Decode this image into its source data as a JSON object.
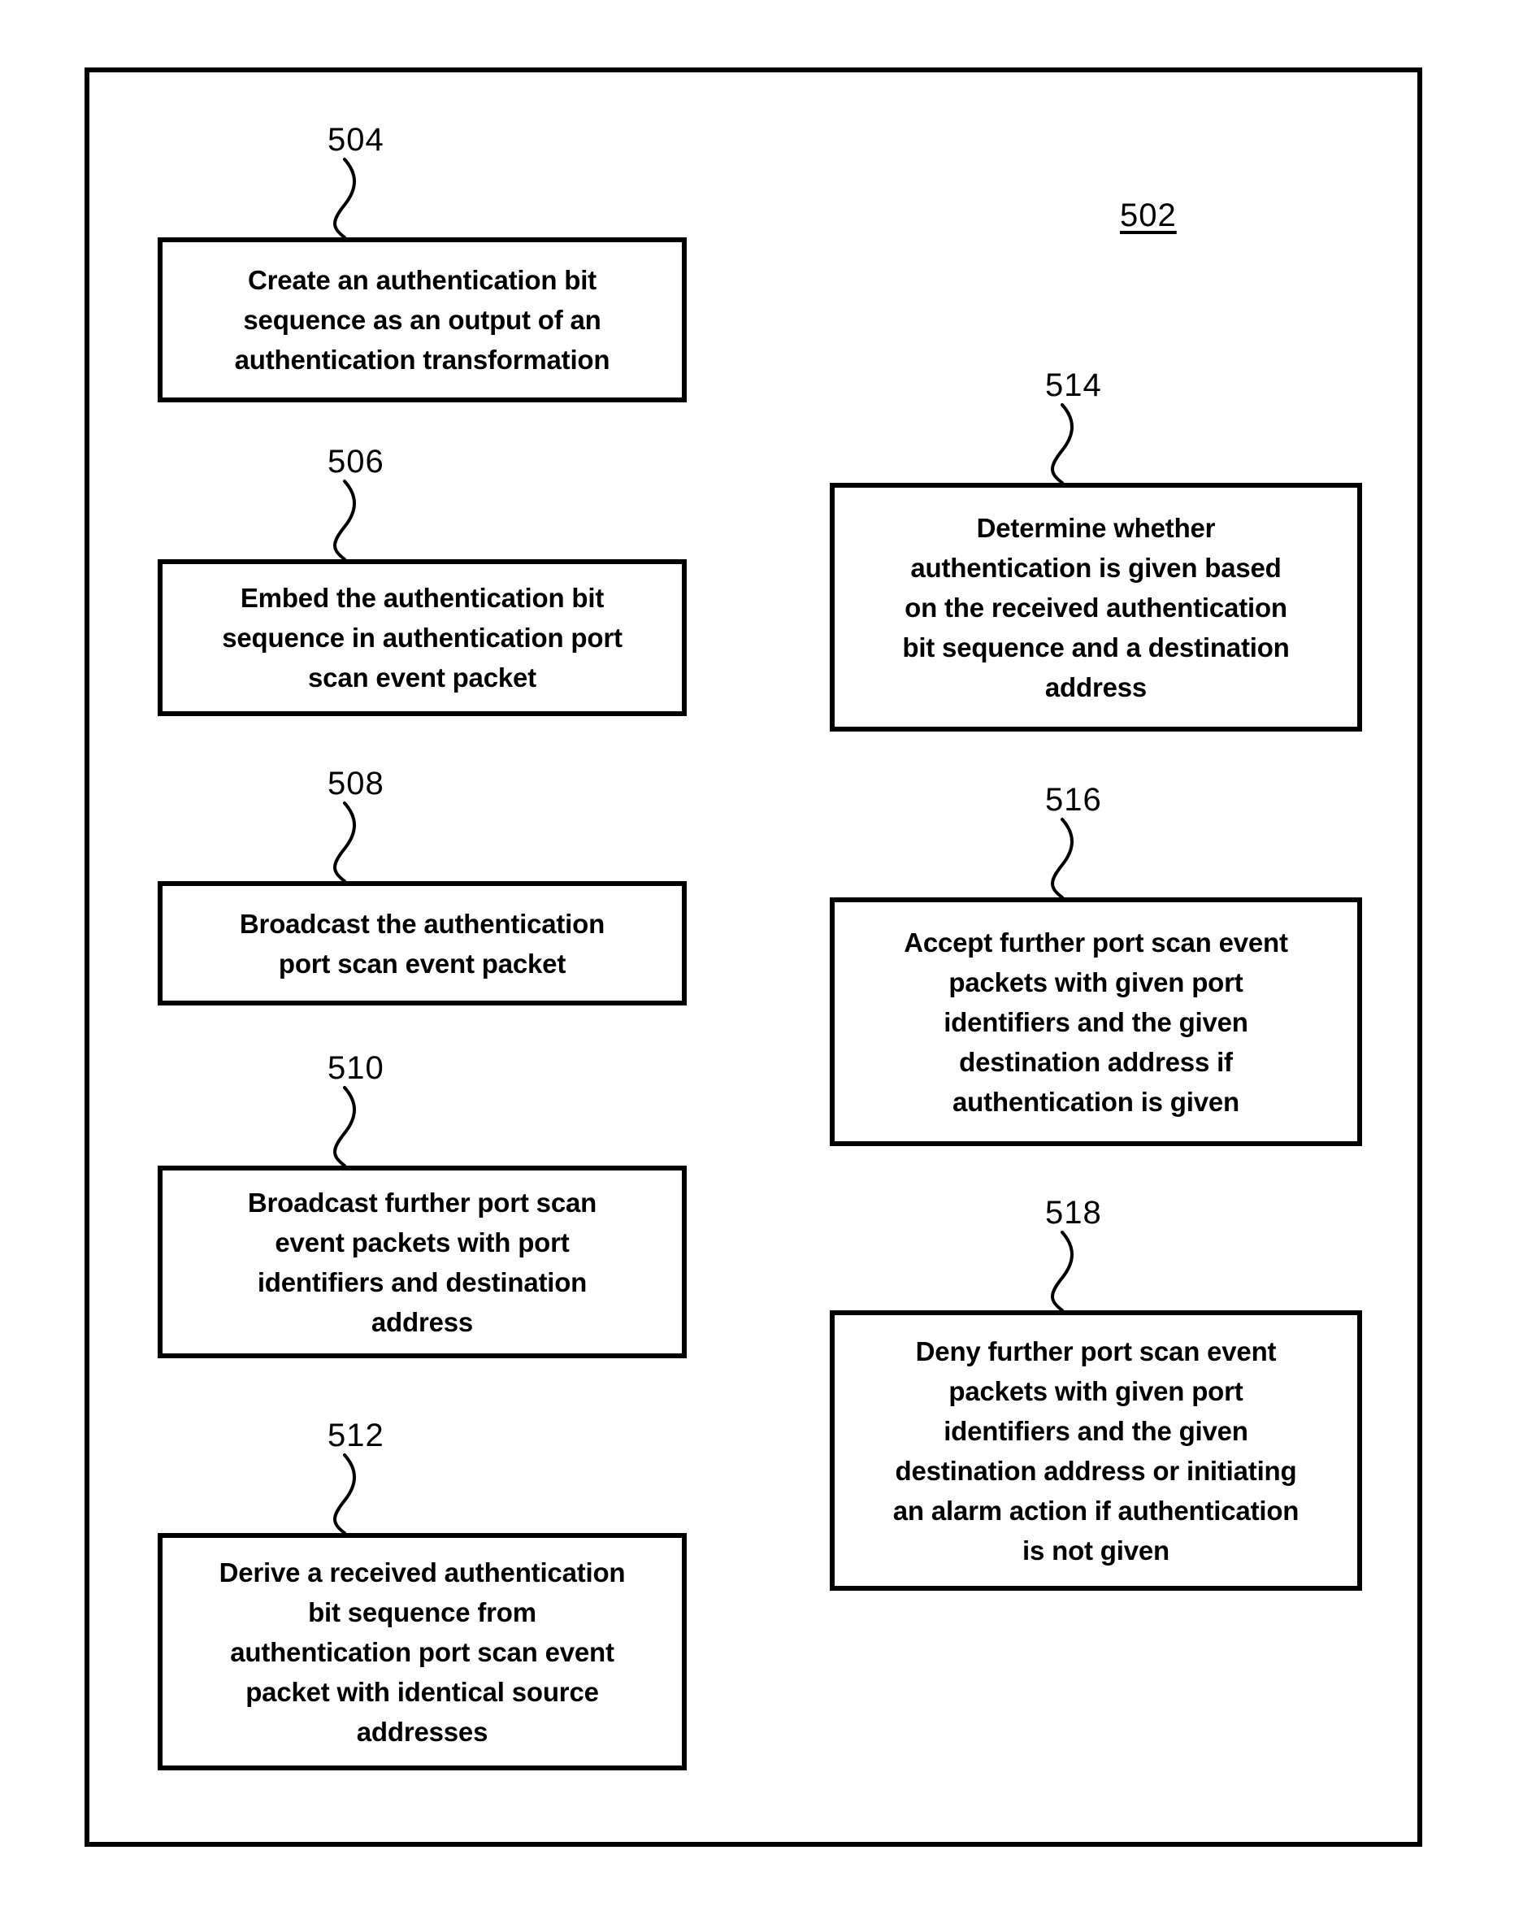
{
  "figure": {
    "figure_label": "502",
    "boxes": [
      {
        "ref": "504",
        "text": "Create an authentication bit\nsequence as an output of an\nauthentication transformation"
      },
      {
        "ref": "506",
        "text": "Embed the authentication bit\nsequence in authentication port\nscan event packet"
      },
      {
        "ref": "508",
        "text": "Broadcast the authentication\nport scan event packet"
      },
      {
        "ref": "510",
        "text": "Broadcast further port scan\nevent packets with port\nidentifiers and destination\naddress"
      },
      {
        "ref": "512",
        "text": "Derive a received authentication\nbit sequence from\nauthentication port scan event\npacket with identical source\naddresses"
      },
      {
        "ref": "514",
        "text": "Determine whether\nauthentication is given based\non the received authentication\nbit sequence and a destination\naddress"
      },
      {
        "ref": "516",
        "text": "Accept further port scan event\npackets with given port\nidentifiers and the given\ndestination address if\nauthentication is given"
      },
      {
        "ref": "518",
        "text": "Deny further port scan event\npackets with given port\nidentifiers and the given\ndestination address or initiating\nan alarm action if authentication\nis not given"
      }
    ]
  },
  "colors": {
    "ink": "#000000",
    "paper": "#ffffff"
  }
}
